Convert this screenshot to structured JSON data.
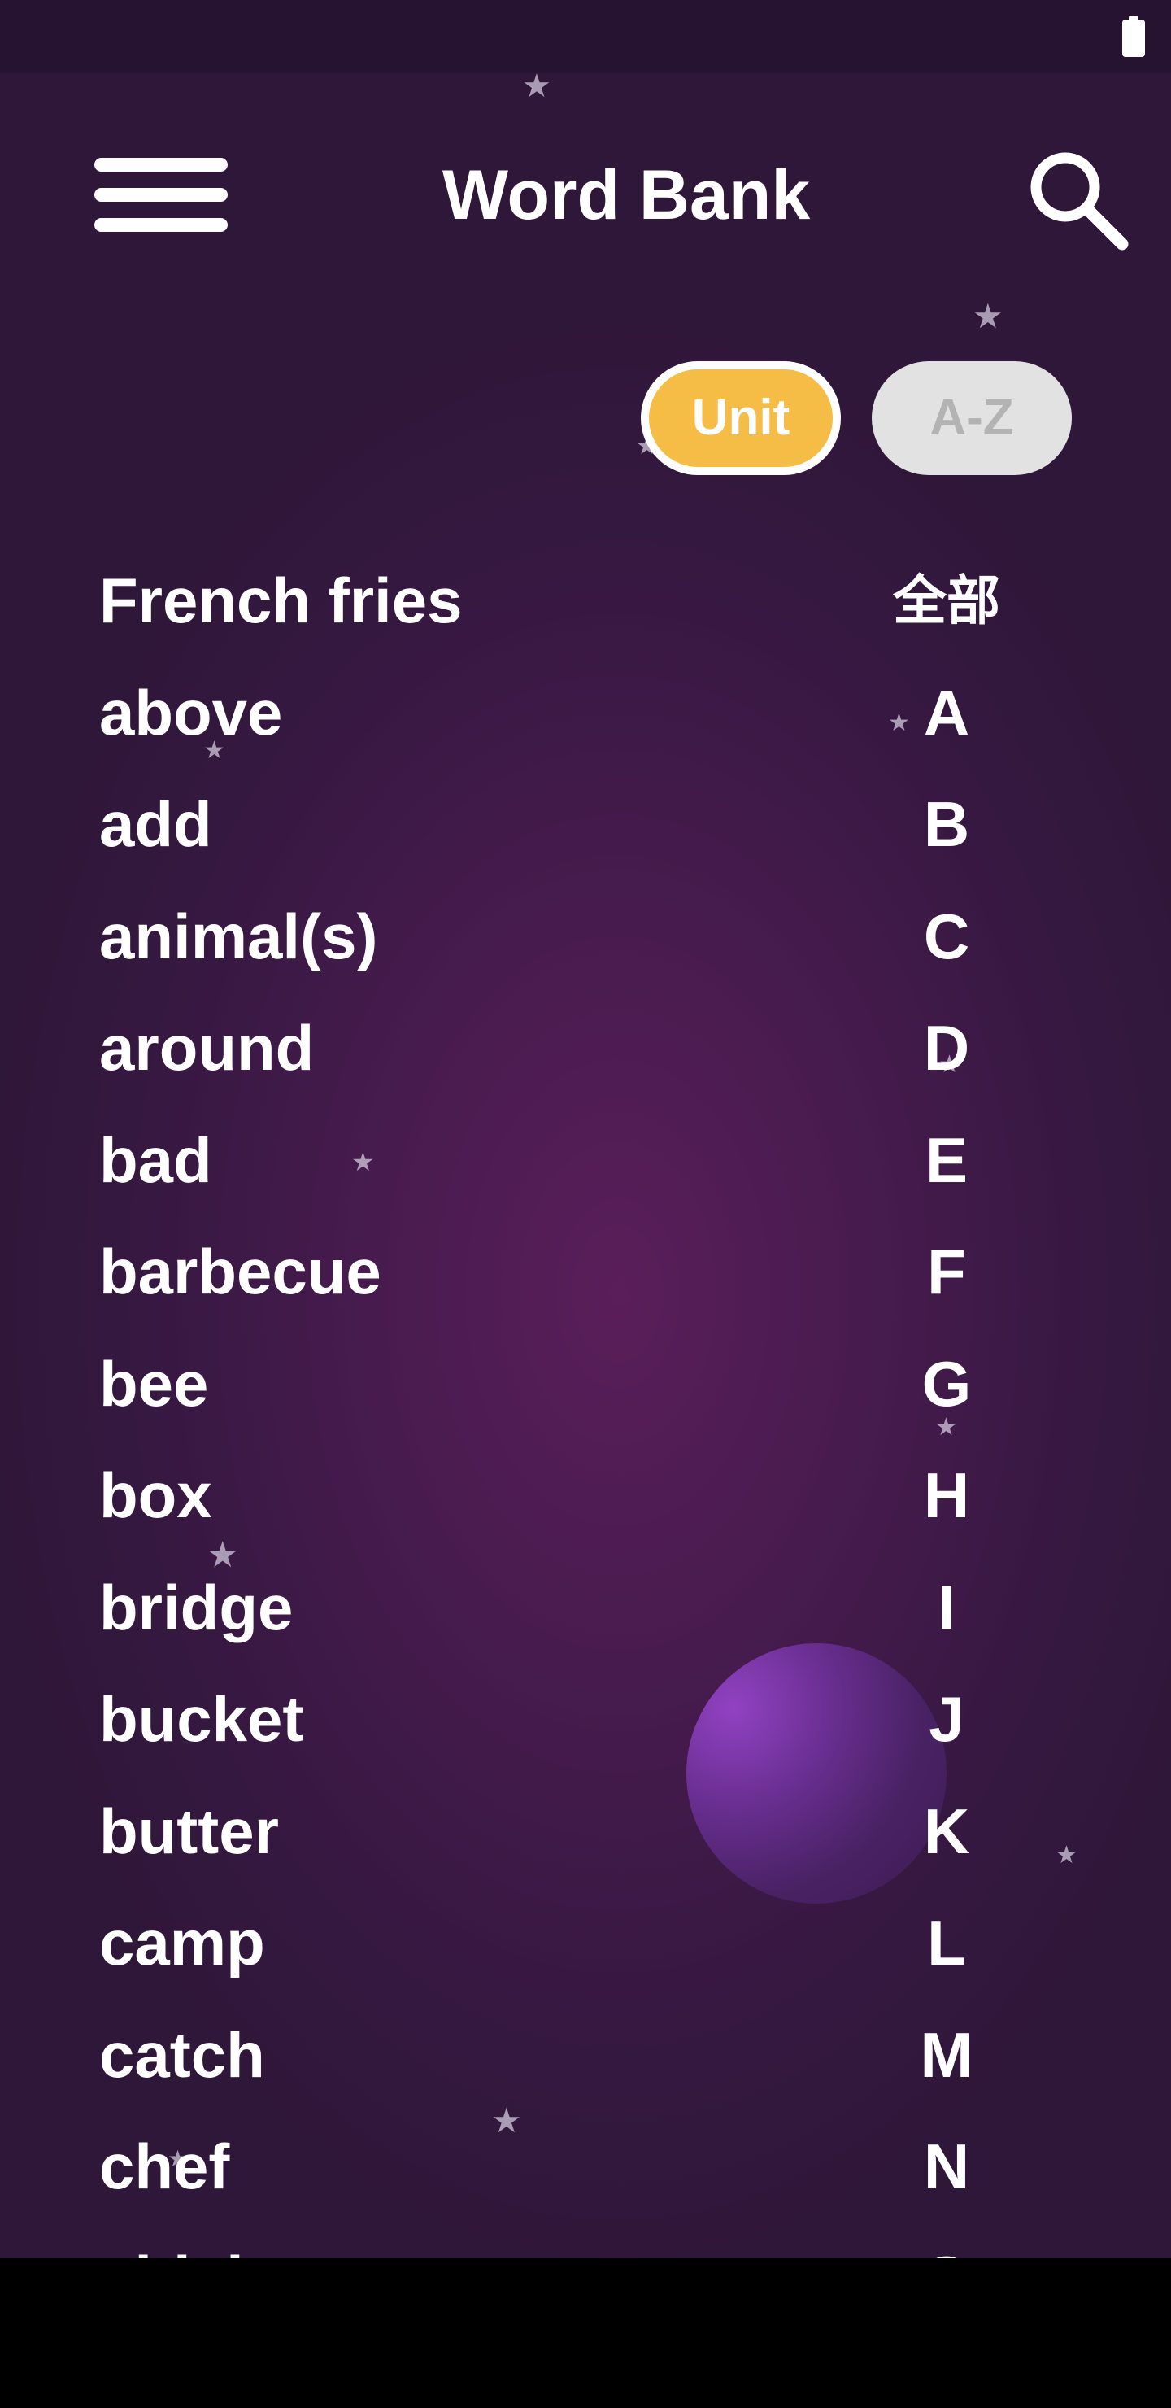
{
  "header": {
    "title": "Word Bank",
    "menu_icon": "hamburger-menu-icon",
    "search_icon": "search-icon"
  },
  "status_bar": {
    "battery_icon": "battery-icon"
  },
  "sort_toggle": {
    "unit_label": "Unit",
    "az_label": "A-Z",
    "selected": "Unit",
    "selected_color": "#f5bd45",
    "unselected_color": "#e2e2e2"
  },
  "words": [
    "French fries",
    "above",
    "add",
    "animal(s)",
    "around",
    "bad",
    "barbecue",
    "bee",
    "box",
    "bridge",
    "bucket",
    "butter",
    "camp",
    "catch",
    "chef",
    "chicken"
  ],
  "alphabet_index": [
    "全部",
    "A",
    "B",
    "C",
    "D",
    "E",
    "F",
    "G",
    "H",
    "I",
    "J",
    "K",
    "L",
    "M",
    "N",
    "O"
  ],
  "colors": {
    "background": "#471b4e",
    "text": "#ffffff"
  }
}
